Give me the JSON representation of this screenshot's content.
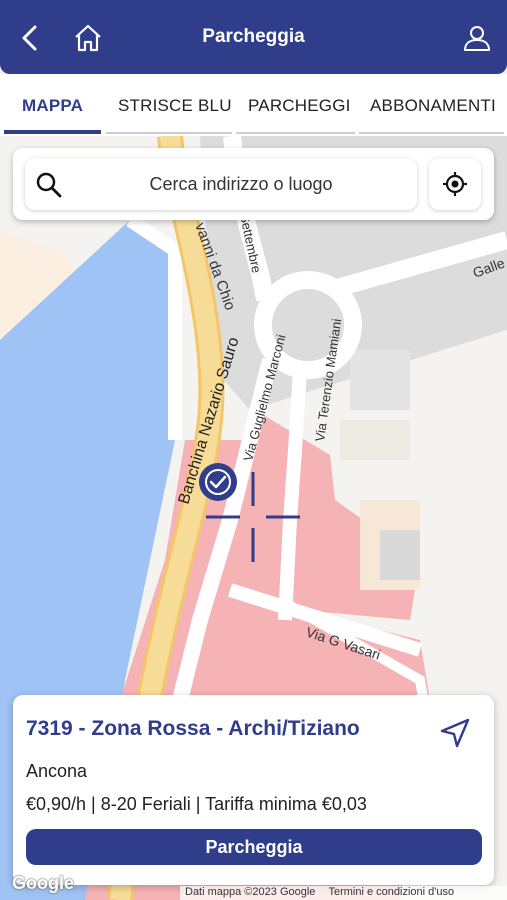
{
  "header": {
    "title": "Parcheggia",
    "back_icon": "chevron-left-icon",
    "home_icon": "home-icon",
    "profile_icon": "user-icon"
  },
  "tabs": [
    {
      "label": "MAPPA",
      "active": true
    },
    {
      "label": "STRISCE BLU",
      "active": false
    },
    {
      "label": "PARCHEGGI",
      "active": false
    },
    {
      "label": "ABBONAMENTI",
      "active": false
    }
  ],
  "search": {
    "placeholder": "Cerca indirizzo o luogo",
    "search_icon": "search-icon",
    "locate_icon": "crosshair-icon"
  },
  "map": {
    "streets": [
      "Banchina Nazario Sauro",
      "Via Guglielmo Marconi",
      "Via Terenzio Mamiani",
      "Via G Vasari",
      "Settembre",
      "vanni da Chio",
      "Galle"
    ],
    "zone_color": "#f6b3b5",
    "water_color": "#9fc3f5",
    "road_color": "#f6d88f"
  },
  "info": {
    "zone_title": "7319 - Zona Rossa - Archi/Tiziano",
    "city": "Ancona",
    "rate": "€0,90/h | 8-20 Feriali | Tariffa minima €0,03",
    "action_label": "Parcheggia",
    "nav_icon": "navigation-arrow-icon"
  },
  "footer": {
    "logo": "Google",
    "map_data": "Dati mappa ©2023 Google",
    "terms": "Termini e condizioni d'uso"
  },
  "colors": {
    "primary": "#2f3d8a"
  }
}
